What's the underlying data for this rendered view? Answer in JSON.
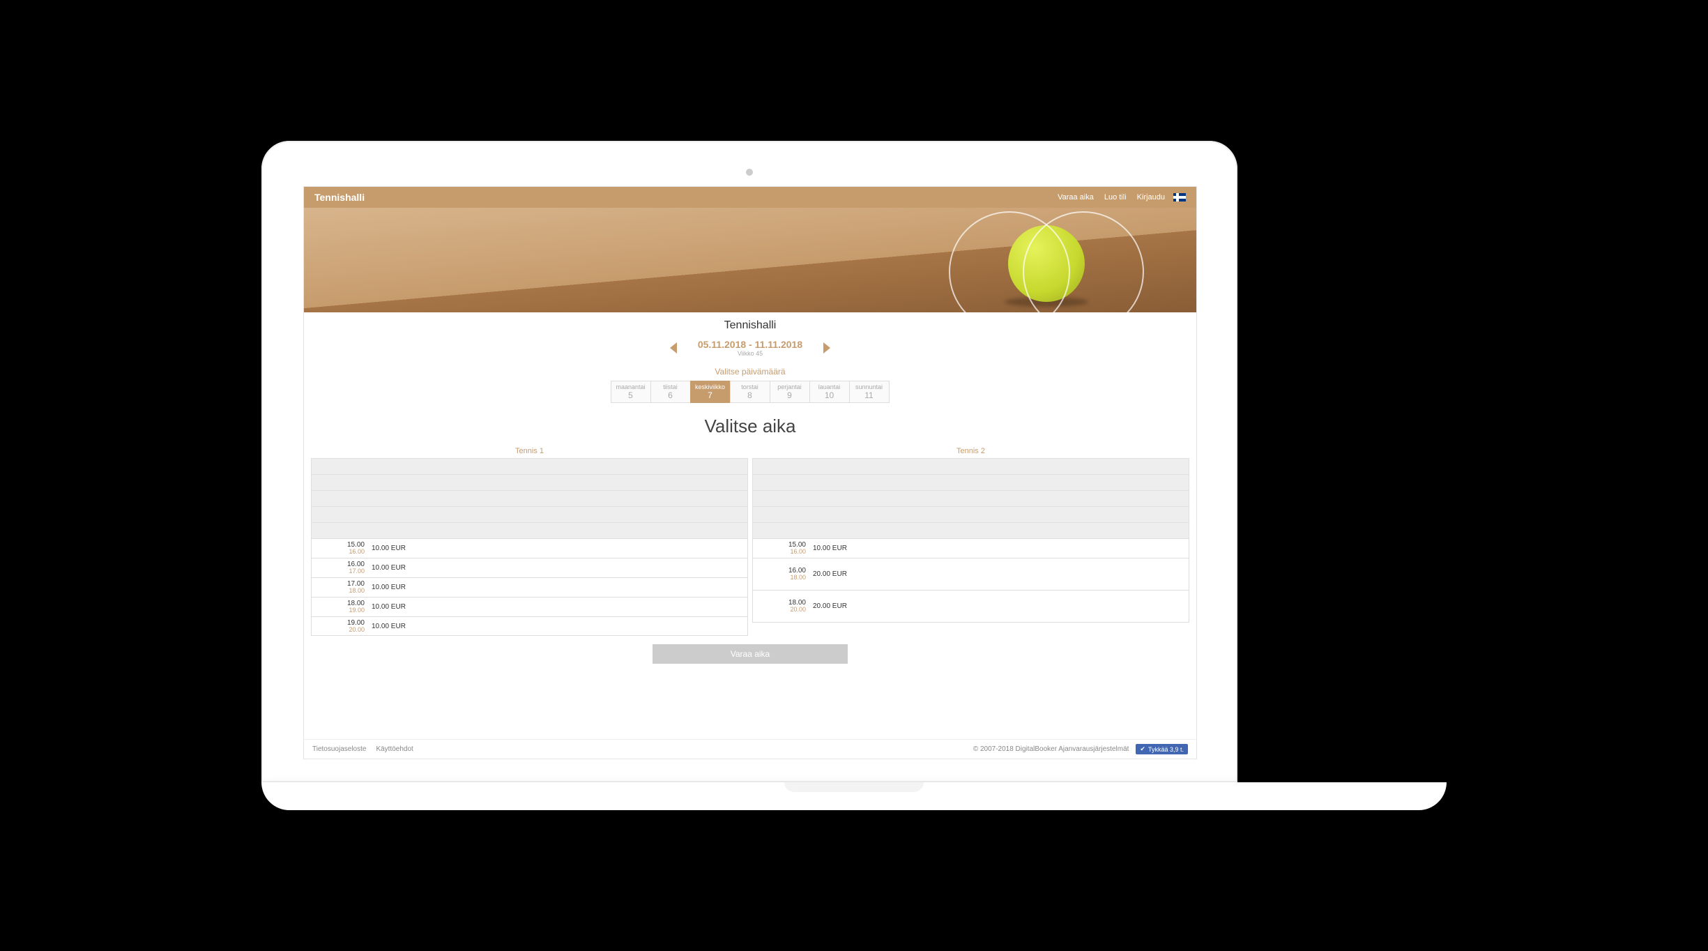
{
  "header": {
    "brand": "Tennishalli",
    "nav": {
      "book": "Varaa aika",
      "create": "Luo tili",
      "login": "Kirjaudu"
    }
  },
  "venue_name": "Tennishalli",
  "week": {
    "range": "05.11.2018 - 11.11.2018",
    "label": "Viikko 45"
  },
  "select_date_label": "Valitse päivämäärä",
  "days": [
    {
      "name": "maanantai",
      "num": "5",
      "active": false
    },
    {
      "name": "tiistai",
      "num": "6",
      "active": false
    },
    {
      "name": "keskiviikko",
      "num": "7",
      "active": true
    },
    {
      "name": "torstai",
      "num": "8",
      "active": false
    },
    {
      "name": "perjantai",
      "num": "9",
      "active": false
    },
    {
      "name": "lauantai",
      "num": "10",
      "active": false
    },
    {
      "name": "sunnuntai",
      "num": "11",
      "active": false
    }
  ],
  "select_time_label": "Valitse aika",
  "courts": [
    {
      "name": "Tennis 1",
      "slots": [
        {
          "start": "15.00",
          "end": "16.00",
          "price": "10.00 EUR",
          "tall": false
        },
        {
          "start": "16.00",
          "end": "17.00",
          "price": "10.00 EUR",
          "tall": false
        },
        {
          "start": "17.00",
          "end": "18.00",
          "price": "10.00 EUR",
          "tall": false
        },
        {
          "start": "18.00",
          "end": "19.00",
          "price": "10.00 EUR",
          "tall": false
        },
        {
          "start": "19.00",
          "end": "20.00",
          "price": "10.00 EUR",
          "tall": false
        }
      ]
    },
    {
      "name": "Tennis 2",
      "slots": [
        {
          "start": "15.00",
          "end": "16.00",
          "price": "10.00 EUR",
          "tall": false
        },
        {
          "start": "16.00",
          "end": "18.00",
          "price": "20.00 EUR",
          "tall": true
        },
        {
          "start": "18.00",
          "end": "20.00",
          "price": "20.00 EUR",
          "tall": true
        }
      ]
    }
  ],
  "book_button": "Varaa aika",
  "footer": {
    "privacy": "Tietosuojaseloste",
    "terms": "Käyttöehdot",
    "copyright": "© 2007-2018 DigitalBooker Ajanvarausjärjestelmät",
    "like": "Tykkää 3,9 t."
  }
}
